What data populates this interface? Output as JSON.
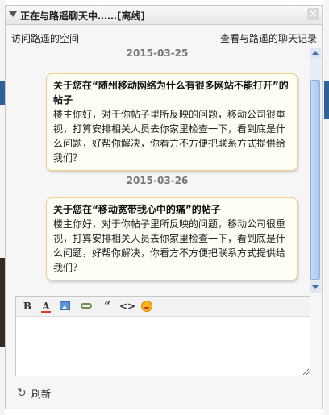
{
  "window": {
    "title": "正在与路遥聊天中……[离线]",
    "close_label": "×"
  },
  "links": {
    "visit_space": "访问路遥的空间",
    "view_history": "查看与路遥的聊天记录"
  },
  "messages": [
    {
      "date": "2015-03-25",
      "title": "关于您在“随州移动网络为什么有很多网站不能打开”的帖子",
      "body": "楼主你好，对于你帖子里所反映的问题，移动公司很重视，打算安排相关人员去你家里检查一下，看到底是什么问题，好帮你解决，你看方不方便把联系方式提供给我们？"
    },
    {
      "date": "2015-03-26",
      "title": "关于您在“移动宽带我心中的痛”的帖子",
      "body": "楼主你好，对于你帖子里所反映的问题，移动公司很重视，打算安排相关人员去你家里检查一下，看到底是什么问题，好帮你解决，你看方不方便把联系方式提供给我们？"
    }
  ],
  "toolbar": {
    "bold": "B",
    "color": "A",
    "quote": "“",
    "code": "<>"
  },
  "editor": {
    "value": ""
  },
  "refresh": {
    "label": "刷新"
  }
}
